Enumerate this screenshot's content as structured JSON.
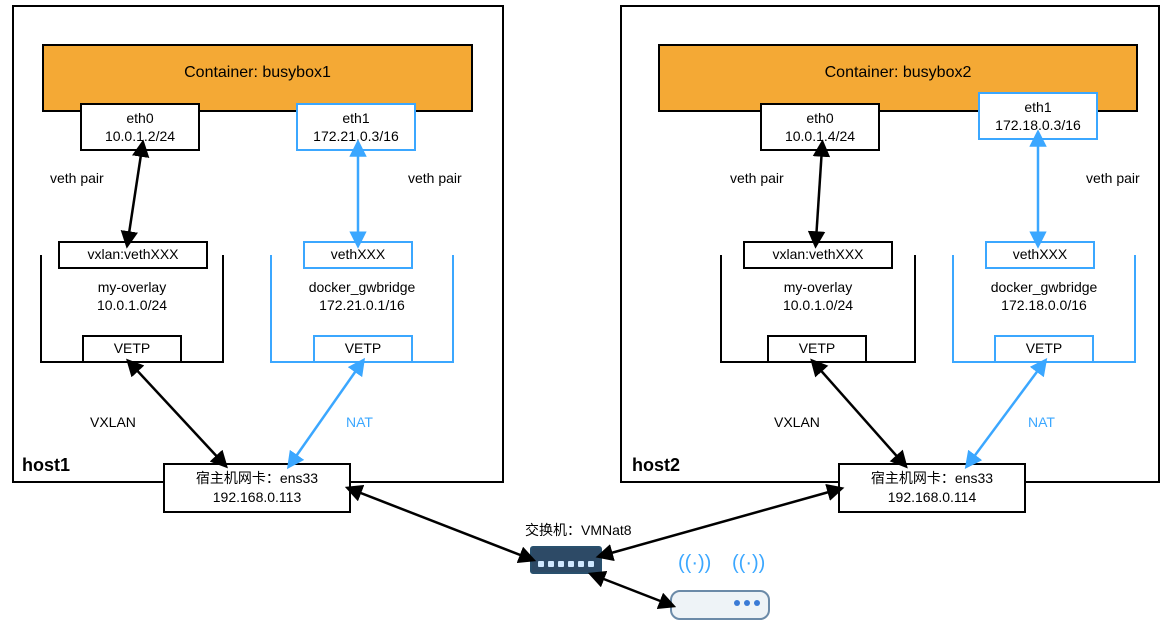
{
  "hosts": {
    "h1": {
      "label": "host1",
      "container_title": "Container: busybox1",
      "eth0": {
        "name": "eth0",
        "ip": "10.0.1.2/24"
      },
      "eth1": {
        "name": "eth1",
        "ip": "172.21.0.3/16"
      },
      "veth_pair_left": "veth pair",
      "veth_pair_right": "veth pair",
      "vxlan_veth": "vxlan:vethXXX",
      "vethxxx": "vethXXX",
      "overlay_net": {
        "name": "my-overlay",
        "cidr": "10.0.1.0/24"
      },
      "gwbridge": {
        "name": "docker_gwbridge",
        "cidr": "172.21.0.1/16"
      },
      "vetp_left": "VETP",
      "vetp_right": "VETP",
      "vxlan_label": "VXLAN",
      "nat_label": "NAT",
      "nic": {
        "label": "宿主机网卡：ens33",
        "ip": "192.168.0.113"
      }
    },
    "h2": {
      "label": "host2",
      "container_title": "Container: busybox2",
      "eth0": {
        "name": "eth0",
        "ip": "10.0.1.4/24"
      },
      "eth1": {
        "name": "eth1",
        "ip": "172.18.0.3/16"
      },
      "veth_pair_left": "veth pair",
      "veth_pair_right": "veth pair",
      "vxlan_veth": "vxlan:vethXXX",
      "vethxxx": "vethXXX",
      "overlay_net": {
        "name": "my-overlay",
        "cidr": "10.0.1.0/24"
      },
      "gwbridge": {
        "name": "docker_gwbridge",
        "cidr": "172.18.0.0/16"
      },
      "vetp_left": "VETP",
      "vetp_right": "VETP",
      "vxlan_label": "VXLAN",
      "nat_label": "NAT",
      "nic": {
        "label": "宿主机网卡：ens33",
        "ip": "192.168.0.114"
      }
    }
  },
  "switch_label": "交换机：VMNat8"
}
